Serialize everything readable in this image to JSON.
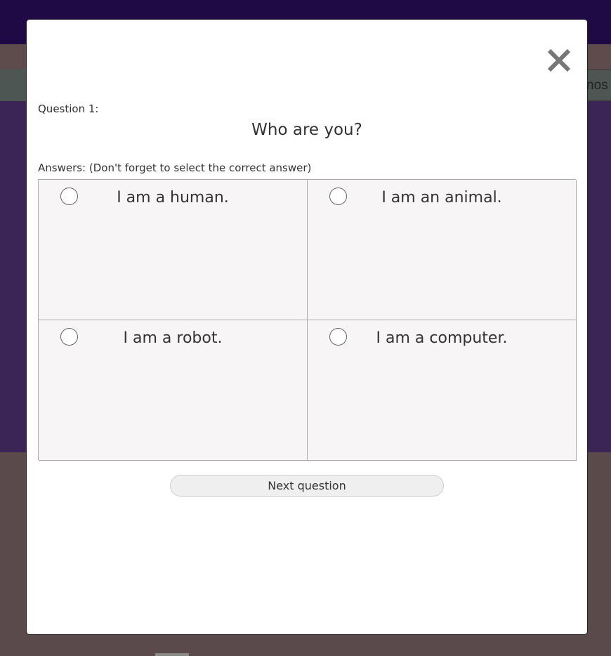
{
  "background": {
    "peek_text": "nos"
  },
  "modal": {
    "close_icon": "close-x-icon",
    "question_label": "Question 1:",
    "question_text": "Who are you?",
    "answers_label": "Answers: (Don't forget to select the correct answer)",
    "answers": [
      {
        "label": "I am a human.",
        "selected": false
      },
      {
        "label": "I am an animal.",
        "selected": false
      },
      {
        "label": "I am a robot.",
        "selected": false
      },
      {
        "label": "I am a computer.",
        "selected": false
      }
    ],
    "next_button": "Next question"
  },
  "colors": {
    "topbar": "#1f0a45",
    "purple_panel": "#3a2556",
    "overlay_dim": "#5a4a4c",
    "close_icon": "#777777",
    "answer_bg": "#f7f5f6"
  }
}
